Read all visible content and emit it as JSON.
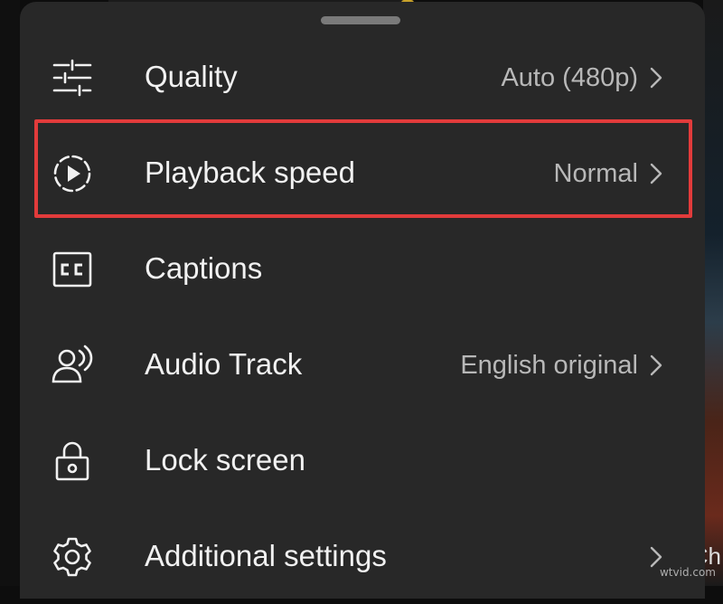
{
  "sheet": {
    "items": [
      {
        "label": "Quality",
        "value": "Auto (480p)",
        "icon": "sliders-icon",
        "has_chevron": true
      },
      {
        "label": "Playback speed",
        "value": "Normal",
        "icon": "playback-speed-icon",
        "has_chevron": true,
        "highlighted": true
      },
      {
        "label": "Captions",
        "value": "",
        "icon": "captions-icon",
        "has_chevron": false
      },
      {
        "label": "Audio Track",
        "value": "English original",
        "icon": "audio-track-icon",
        "has_chevron": true
      },
      {
        "label": "Lock screen",
        "value": "",
        "icon": "lock-icon",
        "has_chevron": false
      },
      {
        "label": "Additional settings",
        "value": "",
        "icon": "gear-icon",
        "has_chevron": true
      }
    ]
  },
  "background": {
    "edge_text": "Ch"
  },
  "watermark": "wtvid.com",
  "colors": {
    "sheet": "#282828",
    "highlight": "#e23b3b",
    "text": "#f1f1f1",
    "value": "#b8b8b8"
  }
}
